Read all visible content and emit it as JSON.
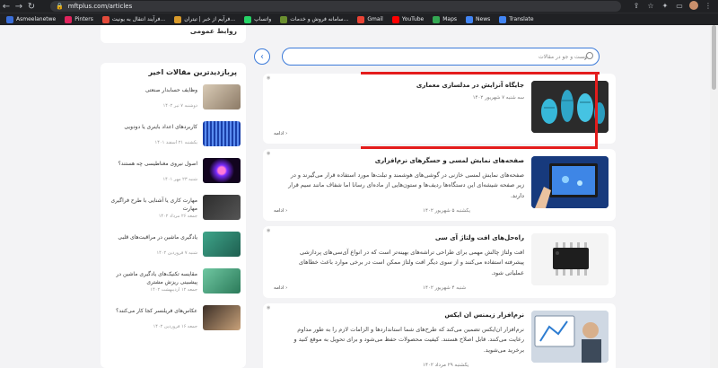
{
  "browser": {
    "url": "mftplus.com/articles",
    "bookmarks": [
      {
        "label": "Asmeelanetwe",
        "color": "#3a6ed8"
      },
      {
        "label": "Pinters",
        "color": "#e0245e"
      },
      {
        "label": "فرآیند انتقال به یونیت...",
        "color": "#e34b3b"
      },
      {
        "label": "فرآیم از خبر | تیتران...",
        "color": "#d89a2b"
      },
      {
        "label": "واتساپ",
        "color": "#25d366"
      },
      {
        "label": "سامانه فروش و خدمات...",
        "color": "#6b8f2f"
      },
      {
        "label": "Gmail",
        "color": "#ea4335"
      },
      {
        "label": "YouTube",
        "color": "#ff0000"
      },
      {
        "label": "Maps",
        "color": "#34a853"
      },
      {
        "label": "News",
        "color": "#4285f4"
      },
      {
        "label": "Translate",
        "color": "#4285f4"
      }
    ]
  },
  "sidebar": {
    "top_box_title": "روابط عمومی",
    "heading": "پربازدیدترین مقالات اخیر",
    "items": [
      {
        "title": "وظایف حسابدار صنعتی",
        "date": "دوشنبه ۷ تیر ۱۴۰۲",
        "thumb": "office"
      },
      {
        "title": "کاربردهای اعداد باینری یا دودویی",
        "date": "یکشنبه ۲۱ اسفند ۱۴۰۱",
        "thumb": "binary"
      },
      {
        "title": "اصول نیروی مغناطیسی چه هستند؟",
        "date": "شنبه ۲۳ مهر ۱۴۰۱",
        "thumb": "magnet"
      },
      {
        "title": "مهارت کاری یا آشنایی با طرح فراگیری مهارت",
        "date": "جمعه ۲۶ مرداد ۱۴۰۲",
        "thumb": "autodesk"
      },
      {
        "title": "یادگیری ماشین در مراقبت‌های قلبی",
        "date": "شنبه ۷ فروردین ۱۴۰۲",
        "thumb": "heart"
      },
      {
        "title": "مقایسه تکنیک‌های یادگیری ماشین در پیشبینی ریزش مشتری",
        "date": "جمعه ۱۲ اردیبهشت ۱۴۰۲",
        "thumb": "ml"
      },
      {
        "title": "عکاس‌های فریلنسر کجا کار می‌کنند؟",
        "date": "جمعه ۱۶ فروردین ۱۴۰۲",
        "thumb": "camera"
      }
    ]
  },
  "search": {
    "placeholder": "جست و جو در مقالات"
  },
  "articles": [
    {
      "title": "جایگاه آنزایش در مدلسازی معماری",
      "excerpt": "",
      "date": "سه شنبه ۷ شهریور ۱۴۰۲",
      "more": "ادامه ›",
      "image": "3d"
    },
    {
      "title": "صفحه‌های نمایش لمسی و حسگرهای نرم‌افزاری",
      "excerpt": "صفحه‌های نمایش لمسی خازنی در گوشی‌های هوشمند و تبلت‌ها مورد استفاده قرار می‌گیرند و در زیر صفحه شیشه‌ای این دستگاه‌ها ردیف‌ها و ستون‌هایی از ماده‌ای رسانا اما شفاف مانند سیم قرار دارند.",
      "date": "یکشنبه ۵ شهریور ۱۴۰۲",
      "more": "ادامه ›",
      "image": "touch"
    },
    {
      "title": "راه‌حل‌های افت ولتاژ آی سی",
      "excerpt": "افت ولتاژ چالش مهمی برای طراحی تراشه‌های بهینه‌تر است که در انواع آی‌سی‌های پردازشی پیشرفته استفاده می‌کنند و از سوی دیگر افت ولتاژ ممکن است در برخی موارد باعث خطاهای عملیاتی شود.",
      "date": "شنبه ۴ شهریور ۱۴۰۲",
      "more": "ادامه ›",
      "image": "chip"
    },
    {
      "title": "نرم‌افزار زیمنس ان ایکس",
      "excerpt": "نرم‌افزار ان‌ایکس تضمین می‌کند که طرح‌های شما استانداردها و الزامات لازم را به طور مداوم رعایت می‌کنند. قابل اصلاح هستند. کیفیت محصولات حفظ می‌شود و برای تحویل به موقع کنید و برخرید می‌شوید.",
      "date": "یکشنبه ۲۹ مرداد ۱۴۰۲",
      "more": "",
      "image": "nx"
    }
  ]
}
